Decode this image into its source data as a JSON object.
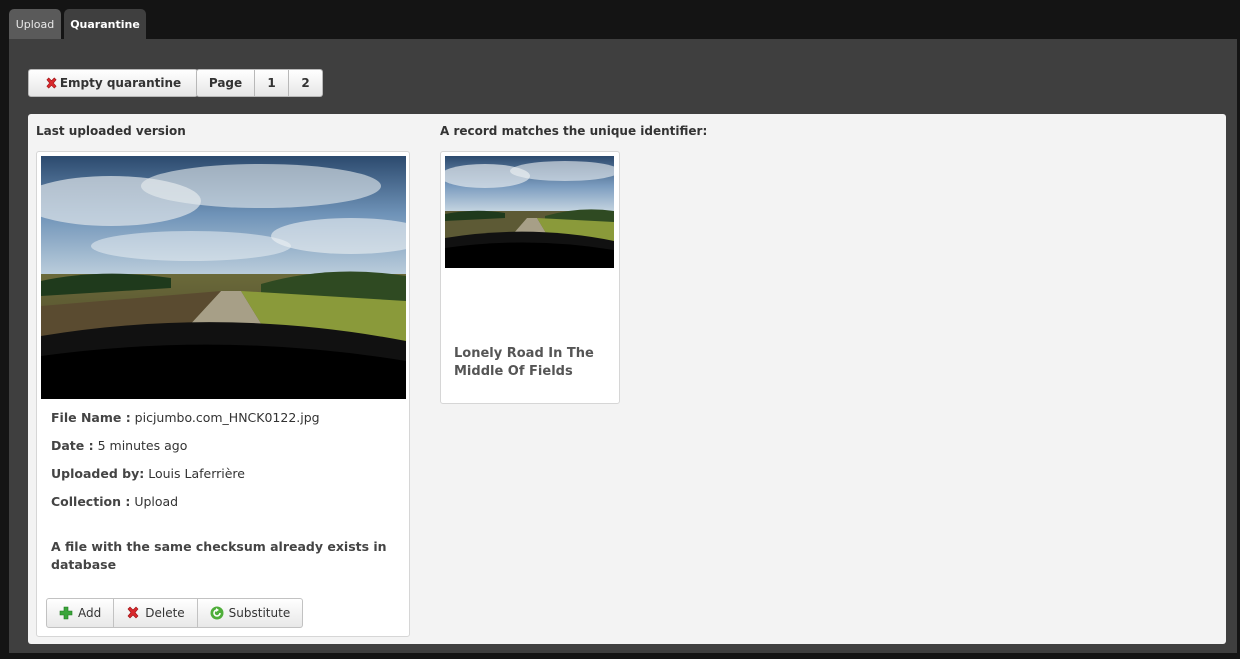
{
  "tabs": [
    {
      "label": "Upload"
    },
    {
      "label": "Quarantine"
    }
  ],
  "toolbar": {
    "empty_label": "Empty quarantine",
    "page_label": "Page",
    "pages": [
      "1",
      "2"
    ]
  },
  "left": {
    "heading": "Last uploaded version",
    "file_name_label": "File Name :",
    "file_name": "picjumbo.com_HNCK0122.jpg",
    "date_label": "Date :",
    "date": "5 minutes ago",
    "uploaded_by_label": "Uploaded by:",
    "uploaded_by": "Louis Laferrière",
    "collection_label": "Collection :",
    "collection": "Upload",
    "warning": "A file with the same checksum already exists in database",
    "actions": {
      "add": "Add",
      "delete": "Delete",
      "substitute": "Substitute"
    }
  },
  "right": {
    "heading": "A record matches the unique identifier:",
    "record_title": "Lonely Road In The Middle Of Fields"
  },
  "icons": {
    "empty": "red-x-icon",
    "add": "green-plus-icon",
    "delete": "red-x-icon",
    "substitute": "green-refresh-icon"
  }
}
